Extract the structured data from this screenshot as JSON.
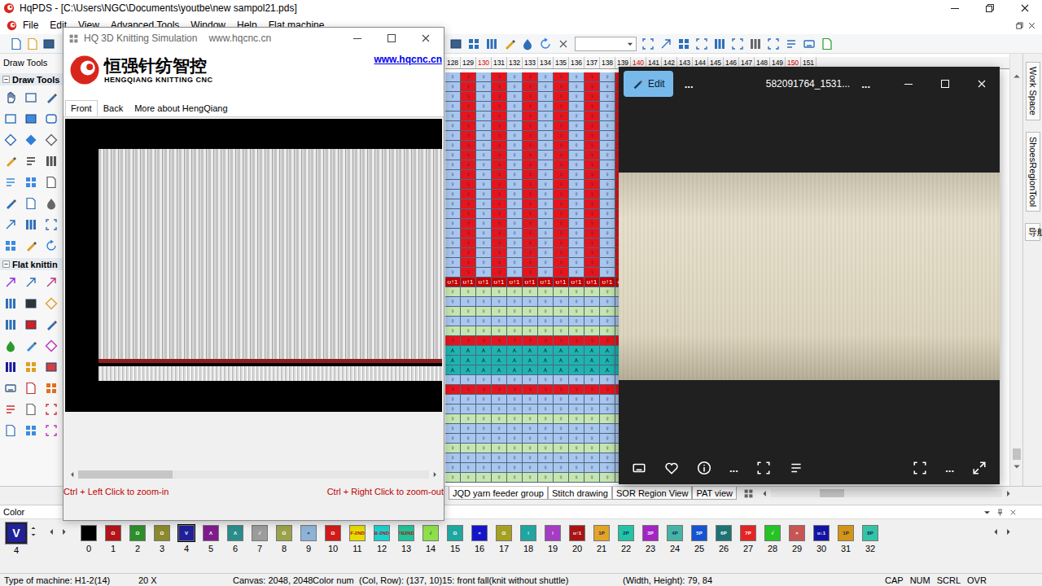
{
  "window": {
    "title": "HqPDS - [C:\\Users\\NGC\\Documents\\youtbe\\new sampol21.pds]"
  },
  "menu": [
    "File",
    "Edit",
    "View",
    "Advanced Tools",
    "Window",
    "Help",
    "Flat machine"
  ],
  "draw_tools": {
    "title": "Draw Tools",
    "sections": [
      {
        "label": "Draw Tools",
        "expanded": true
      },
      {
        "label": "Flat knittin",
        "expanded": true
      }
    ]
  },
  "ruler": [
    {
      "label": "128",
      "major": false
    },
    {
      "label": "129",
      "major": false
    },
    {
      "label": "130",
      "major": true
    },
    {
      "label": "131",
      "major": false
    },
    {
      "label": "132",
      "major": false
    },
    {
      "label": "133",
      "major": false
    },
    {
      "label": "134",
      "major": false
    },
    {
      "label": "135",
      "major": false
    },
    {
      "label": "136",
      "major": false
    },
    {
      "label": "137",
      "major": false
    },
    {
      "label": "138",
      "major": false
    },
    {
      "label": "139",
      "major": false
    },
    {
      "label": "140",
      "major": true
    },
    {
      "label": "141",
      "major": false
    },
    {
      "label": "142",
      "major": false
    },
    {
      "label": "143",
      "major": false
    },
    {
      "label": "144",
      "major": false
    },
    {
      "label": "145",
      "major": false
    },
    {
      "label": "146",
      "major": false
    },
    {
      "label": "147",
      "major": false
    },
    {
      "label": "148",
      "major": false
    },
    {
      "label": "149",
      "major": false
    },
    {
      "label": "150",
      "major": true
    },
    {
      "label": "151",
      "major": false
    }
  ],
  "pattern": {
    "bands": [
      {
        "rows": 21,
        "colors": [
          "#a9c6ee",
          "#e5151b"
        ],
        "symbol": "♀",
        "symbol_color": "#1a2a6a"
      },
      {
        "rows": 1,
        "colors": [
          "#c40000"
        ],
        "symbol": "ʊ↑1",
        "symbol_color": "#ffffff"
      },
      {
        "rows": 1,
        "colors": [
          "#c6e6ae"
        ],
        "symbol": "♀",
        "symbol_color": "#1a2a6a"
      },
      {
        "rows": 1,
        "colors": [
          "#a9c6ee"
        ],
        "symbol": "♀",
        "symbol_color": "#1a2a6a"
      },
      {
        "rows": 1,
        "colors": [
          "#c6e6ae"
        ],
        "symbol": "♀",
        "symbol_color": "#1a2a6a"
      },
      {
        "rows": 1,
        "colors": [
          "#a9c6ee"
        ],
        "symbol": "♀",
        "symbol_color": "#1a2a6a"
      },
      {
        "rows": 1,
        "colors": [
          "#c6e6ae"
        ],
        "symbol": "♀",
        "symbol_color": "#1a2a6a"
      },
      {
        "rows": 1,
        "colors": [
          "#e5151b"
        ],
        "symbol": "♀",
        "symbol_color": "#1a2a6a"
      },
      {
        "rows": 3,
        "colors": [
          "#1fb4b0"
        ],
        "symbol": "⋏",
        "symbol_color": "#0a2a3a"
      },
      {
        "rows": 1,
        "colors": [
          "#a9c6ee"
        ],
        "symbol": "♀",
        "symbol_color": "#1a2a6a"
      },
      {
        "rows": 1,
        "colors": [
          "#e5151b"
        ],
        "symbol": "♀",
        "symbol_color": "#1a2a6a"
      },
      {
        "rows": 2,
        "colors": [
          "#a9c6ee"
        ],
        "symbol": "♀",
        "symbol_color": "#1a2a6a"
      },
      {
        "rows": 1,
        "colors": [
          "#c6e6ae"
        ],
        "symbol": "♀",
        "symbol_color": "#1a2a6a"
      },
      {
        "rows": 2,
        "colors": [
          "#a9c6ee"
        ],
        "symbol": "♀",
        "symbol_color": "#1a2a6a"
      },
      {
        "rows": 1,
        "colors": [
          "#c6e6ae"
        ],
        "symbol": "♀",
        "symbol_color": "#1a2a6a"
      },
      {
        "rows": 2,
        "colors": [
          "#a9c6ee"
        ],
        "symbol": "♀",
        "symbol_color": "#1a2a6a"
      },
      {
        "rows": 1,
        "colors": [
          "#c6e6ae"
        ],
        "symbol": "♀",
        "symbol_color": "#1a2a6a"
      }
    ]
  },
  "side_tabs": [
    {
      "label": "Work Space",
      "kind": "rotated"
    },
    {
      "label": "ShoesRegionTool",
      "kind": "rotated"
    },
    {
      "label": "导航栏",
      "kind": "stacked"
    }
  ],
  "view_tabs": [
    {
      "label": "JQD yarn feeder group",
      "selected": false
    },
    {
      "label": "Stitch drawing",
      "selected": false
    },
    {
      "label": "SOR Region View",
      "selected": false
    },
    {
      "label": "PAT view",
      "selected": false
    }
  ],
  "color_panel": {
    "title": "Color",
    "swatches": [
      {
        "num": "0",
        "color": "#000000",
        "glyph": "",
        "glyph_color": "#ffffff",
        "selected": false
      },
      {
        "num": "1",
        "color": "#b3141a",
        "glyph": "Ω",
        "glyph_color": "#ffffff",
        "selected": false
      },
      {
        "num": "2",
        "color": "#2c8f2c",
        "glyph": "Ω",
        "glyph_color": "#ffffff",
        "selected": false
      },
      {
        "num": "3",
        "color": "#8c8a2c",
        "glyph": "Ω",
        "glyph_color": "#ffffff",
        "selected": false
      },
      {
        "num": "4",
        "color": "#20209a",
        "glyph": "V",
        "glyph_color": "#ffffff",
        "selected": true
      },
      {
        "num": "5",
        "color": "#7e1c8c",
        "glyph": "Λ",
        "glyph_color": "#ffffff",
        "selected": false
      },
      {
        "num": "6",
        "color": "#2b8d8a",
        "glyph": "Λ",
        "glyph_color": "#ffffff",
        "selected": false
      },
      {
        "num": "7",
        "color": "#9c9c9c",
        "glyph": "√",
        "glyph_color": "#ffffff",
        "selected": false
      },
      {
        "num": "8",
        "color": "#9aa24a",
        "glyph": "Ω",
        "glyph_color": "#ffffff",
        "selected": false
      },
      {
        "num": "9",
        "color": "#8db4d6",
        "glyph": "×",
        "glyph_color": "#1a2a6a",
        "selected": false
      },
      {
        "num": "10",
        "color": "#d11b1b",
        "glyph": "Ω",
        "glyph_color": "#ffffff",
        "selected": false
      },
      {
        "num": "11",
        "color": "#e6dc00",
        "glyph": "F-2ND",
        "glyph_color": "#b01010",
        "selected": false
      },
      {
        "num": "12",
        "color": "#1ecfcf",
        "glyph": "B-2ND",
        "glyph_color": "#b01010",
        "selected": false
      },
      {
        "num": "13",
        "color": "#1fc49a",
        "glyph": "FB2ND",
        "glyph_color": "#b01010",
        "selected": false
      },
      {
        "num": "14",
        "color": "#8ee04a",
        "glyph": "√",
        "glyph_color": "#1a4a1a",
        "selected": false
      },
      {
        "num": "15",
        "color": "#1fa6a0",
        "glyph": "Ω",
        "glyph_color": "#ffffff",
        "selected": false
      },
      {
        "num": "16",
        "color": "#1414c8",
        "glyph": "×",
        "glyph_color": "#ffffff",
        "selected": false
      },
      {
        "num": "17",
        "color": "#a6a020",
        "glyph": "Ω",
        "glyph_color": "#ffffff",
        "selected": false
      },
      {
        "num": "18",
        "color": "#20a6a0",
        "glyph": "⁞",
        "glyph_color": "#ffffff",
        "selected": false
      },
      {
        "num": "19",
        "color": "#a43cc4",
        "glyph": "⁞",
        "glyph_color": "#ffffff",
        "selected": false
      },
      {
        "num": "20",
        "color": "#a81414",
        "glyph": "ʊ↑1",
        "glyph_color": "#ffffff",
        "selected": false
      },
      {
        "num": "21",
        "color": "#e2a424",
        "glyph": "1P",
        "glyph_color": "#1a1a6a",
        "selected": false
      },
      {
        "num": "22",
        "color": "#22c4a4",
        "glyph": "2P",
        "glyph_color": "#1a1a6a",
        "selected": false
      },
      {
        "num": "23",
        "color": "#a424c4",
        "glyph": "3P",
        "glyph_color": "#ffffff",
        "selected": false
      },
      {
        "num": "24",
        "color": "#46b4a4",
        "glyph": "4P",
        "glyph_color": "#1a1a6a",
        "selected": false
      },
      {
        "num": "25",
        "color": "#1454d4",
        "glyph": "5P",
        "glyph_color": "#ffffff",
        "selected": false
      },
      {
        "num": "26",
        "color": "#1f7272",
        "glyph": "6P",
        "glyph_color": "#ffffff",
        "selected": false
      },
      {
        "num": "27",
        "color": "#e42424",
        "glyph": "7P",
        "glyph_color": "#ffffff",
        "selected": false
      },
      {
        "num": "28",
        "color": "#24c424",
        "glyph": "√",
        "glyph_color": "#ffffff",
        "selected": false
      },
      {
        "num": "29",
        "color": "#c85454",
        "glyph": "×",
        "glyph_color": "#ffffff",
        "selected": false
      },
      {
        "num": "30",
        "color": "#1414a4",
        "glyph": "ʊ↓1",
        "glyph_color": "#ffffff",
        "selected": false
      },
      {
        "num": "31",
        "color": "#d49414",
        "glyph": "1P",
        "glyph_color": "#1a1a6a",
        "selected": false
      },
      {
        "num": "32",
        "color": "#32c4a4",
        "glyph": "8P",
        "glyph_color": "#1a1a6a",
        "selected": false
      }
    ]
  },
  "status_bar": [
    {
      "text": "Type of machine: H1-2(14)"
    },
    {
      "text": "20 X"
    },
    {
      "text": "Canvas: 2048, 2048"
    },
    {
      "text": "Color num"
    },
    {
      "text": "(Col, Row): (137, 10)15: front fall(knit without shuttle)"
    },
    {
      "text": "(Width, Height): 79, 84"
    }
  ],
  "indicators": [
    "CAP",
    "NUM",
    "SCRL",
    "OVR"
  ],
  "simulation": {
    "title": "HQ 3D Knitting Simulation",
    "url": "www.hqcnc.cn",
    "logo_cn": "恒强针纺智控",
    "logo_en": "HENGQIANG KNITTING CNC",
    "link": "www.hqcnc.cn",
    "tabs": [
      {
        "label": "Front",
        "selected": true
      },
      {
        "label": "Back",
        "selected": false
      },
      {
        "label": "More about HengQiang",
        "selected": false
      }
    ],
    "hint_left": "Ctrl + Left Click to zoom-in",
    "hint_right": "Ctrl + Right Click to zoom-out"
  },
  "viewer": {
    "edit": "Edit",
    "title": "582091764_1531...",
    "menus": [
      "...",
      "..."
    ],
    "bottom_menus": [
      "...",
      "..."
    ]
  }
}
